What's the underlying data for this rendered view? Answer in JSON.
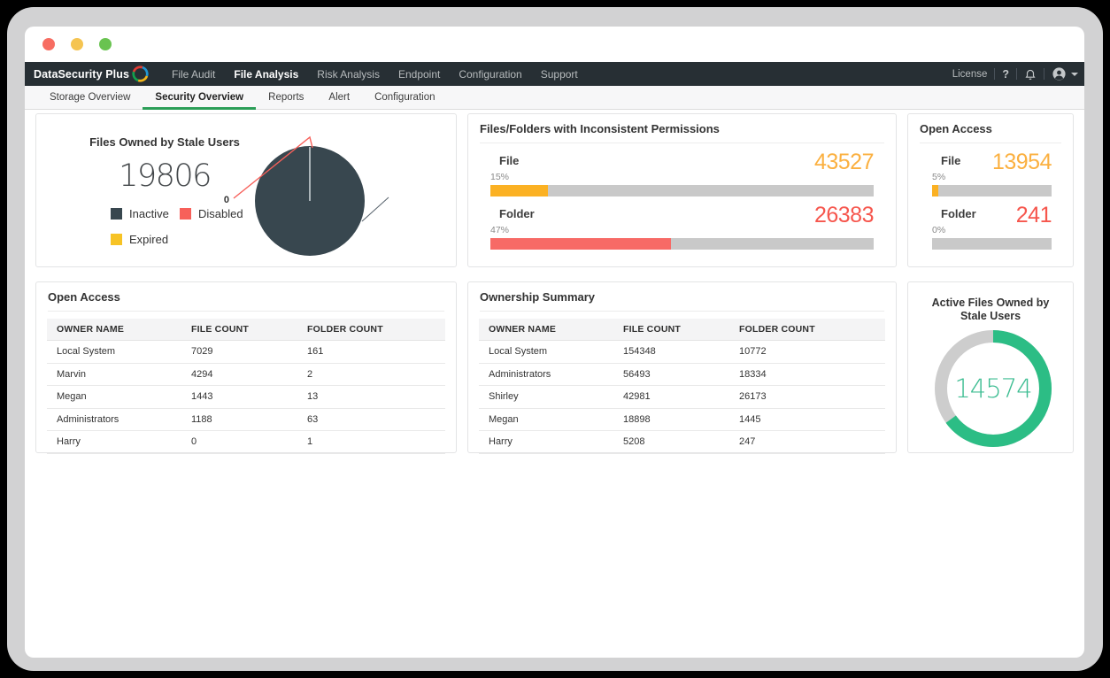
{
  "palette": {
    "accent_green": "#2b9e57",
    "nav_bg": "#272f34",
    "orange": "#fbb040",
    "orange_bar": "#fbb123",
    "red": "#f6564d",
    "red_bar": "#f76a66",
    "slate": "#38474f",
    "legend_red": "#f7605a",
    "legend_yellow": "#f7c325",
    "donut_green": "#2cbd85",
    "donut_track": "#cdcdcd",
    "bar_track": "#c9c9c9",
    "traffic_lights": [
      "#f76d62",
      "#f5c451",
      "#69c350"
    ]
  },
  "nav": {
    "brand": "DataSecurity Plus",
    "items": [
      {
        "label": "File Audit",
        "active": false
      },
      {
        "label": "File Analysis",
        "active": true
      },
      {
        "label": "Risk Analysis",
        "active": false
      },
      {
        "label": "Endpoint",
        "active": false
      },
      {
        "label": "Configuration",
        "active": false
      },
      {
        "label": "Support",
        "active": false
      }
    ],
    "license_label": "License",
    "help_label": "?"
  },
  "tabs": [
    {
      "label": "Storage Overview",
      "active": false
    },
    {
      "label": "Security Overview",
      "active": true
    },
    {
      "label": "Reports",
      "active": false
    },
    {
      "label": "Alert",
      "active": false
    },
    {
      "label": "Configuration",
      "active": false
    }
  ],
  "cards": {
    "stale_users": {
      "title": "Files Owned by Stale Users",
      "total": "19806",
      "callout_value": "0",
      "legend": [
        {
          "label": "Inactive",
          "color": "#38474f"
        },
        {
          "label": "Disabled",
          "color": "#f7605a"
        },
        {
          "label": "Expired",
          "color": "#f7c325"
        }
      ]
    },
    "inconsistent": {
      "title": "Files/Folders with Inconsistent Permissions",
      "rows": [
        {
          "label": "File",
          "value": "43527",
          "percent": "15%",
          "pct": 15,
          "num_color": "#fbb040",
          "bar_color": "#fbb123"
        },
        {
          "label": "Folder",
          "value": "26383",
          "percent": "47%",
          "pct": 47,
          "num_color": "#f6564d",
          "bar_color": "#f76a66"
        }
      ]
    },
    "open_access_bars": {
      "title": "Open Access",
      "rows": [
        {
          "label": "File",
          "value": "13954",
          "percent": "5%",
          "pct": 5,
          "num_color": "#fbb040",
          "bar_color": "#fbb123"
        },
        {
          "label": "Folder",
          "value": "241",
          "percent": "0%",
          "pct": 0,
          "num_color": "#f6564d",
          "bar_color": "#f76a66"
        }
      ]
    },
    "open_access_table": {
      "title": "Open Access",
      "columns": [
        "OWNER NAME",
        "FILE COUNT",
        "FOLDER COUNT"
      ],
      "rows": [
        [
          "Local System",
          "7029",
          "161"
        ],
        [
          "Marvin",
          "4294",
          "2"
        ],
        [
          "Megan",
          "1443",
          "13"
        ],
        [
          "Administrators",
          "1188",
          "63"
        ],
        [
          "Harry",
          "0",
          "1"
        ]
      ]
    },
    "ownership": {
      "title": "Ownership Summary",
      "columns": [
        "OWNER NAME",
        "FILE COUNT",
        "FOLDER COUNT"
      ],
      "rows": [
        [
          "Local System",
          "154348",
          "10772"
        ],
        [
          "Administrators",
          "56493",
          "18334"
        ],
        [
          "Shirley",
          "42981",
          "26173"
        ],
        [
          "Megan",
          "18898",
          "1445"
        ],
        [
          "Harry",
          "5208",
          "247"
        ]
      ]
    },
    "active_files": {
      "title_lines": [
        "Active Files Owned by",
        "Stale Users"
      ],
      "value": "14574",
      "percent_green": 65
    }
  }
}
